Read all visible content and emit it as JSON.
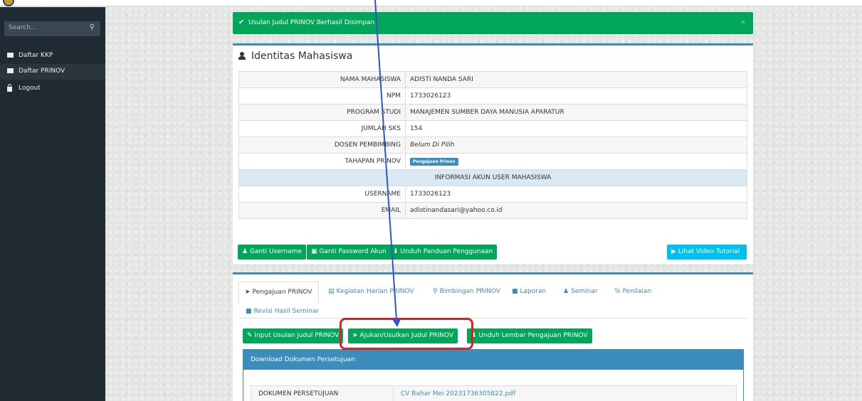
{
  "sidebar": {
    "search_placeholder": "Search...",
    "items": [
      {
        "label": "Daftar KKP",
        "icon": "list-icon"
      },
      {
        "label": "Daftar PRINOV",
        "icon": "list-icon"
      },
      {
        "label": "Logout",
        "icon": "lock-icon"
      }
    ]
  },
  "alert": {
    "message": "Usulan Judul PRINOV Berhasil Disimpan",
    "close": "×"
  },
  "identity": {
    "title": "Identitas Mahasiswa",
    "rows": [
      {
        "label": "NAMA MAHASISWA",
        "value": "ADISTI NANDA SARI"
      },
      {
        "label": "NPM",
        "value": "1733026123"
      },
      {
        "label": "PROGRAM STUDI",
        "value": "MANAJEMEN SUMBER DAYA MANUSIA APARATUR"
      },
      {
        "label": "JUMLAH SKS",
        "value": "154"
      },
      {
        "label": "DOSEN PEMBIMBING",
        "value": "Belum Di Pilih"
      },
      {
        "label": "TAHAPAN PRINOV",
        "value": "Pengajuan Prinov"
      },
      {
        "label": "USERNAME",
        "value": "1733026123"
      },
      {
        "label": "EMAIL",
        "value": "adistinandasari@yahoo.co.id"
      }
    ],
    "section_header": "INFORMASI AKUN USER MAHASISWA"
  },
  "actions": {
    "ganti_username": "Ganti Username",
    "ganti_password": "Ganti Password Akun",
    "unduh_panduan": "Unduh Panduan Penggunaan",
    "lihat_video": "Lihat Video Tutorial"
  },
  "tabs": [
    {
      "label": "Pengajuan PRINOV",
      "icon": "send-icon"
    },
    {
      "label": "Kegiatan Harian PRINOV",
      "icon": "list-icon"
    },
    {
      "label": "Bimbingan PRINOV",
      "icon": "search-icon"
    },
    {
      "label": "Laporan",
      "icon": "file-icon"
    },
    {
      "label": "Seminar",
      "icon": "user-icon"
    },
    {
      "label": "Penilaian",
      "icon": "percent-icon"
    },
    {
      "label": "Revisi Hasil Seminar",
      "icon": "file-icon"
    }
  ],
  "tab_actions": {
    "input_usulan": "Input Usulan Judul PRINOV",
    "ajukan": "Ajukan/Usulkan Judul PRINOV",
    "unduh_lembar": "Unduh Lembar Pengajuan PRINOV"
  },
  "download_panel": {
    "title": "Download Dokumen Persetujuan",
    "doc_label": "DOKUMEN PERSETUJUAN",
    "doc_value": "CV Bahar Mei 20231736305822.pdf"
  },
  "colors": {
    "primary": "#3c8dbc",
    "success": "#00a65a",
    "info": "#00c0ef",
    "sidebar": "#1f2a33",
    "annotation_red": "#e02020",
    "annotation_arrow": "#2f55c9"
  }
}
